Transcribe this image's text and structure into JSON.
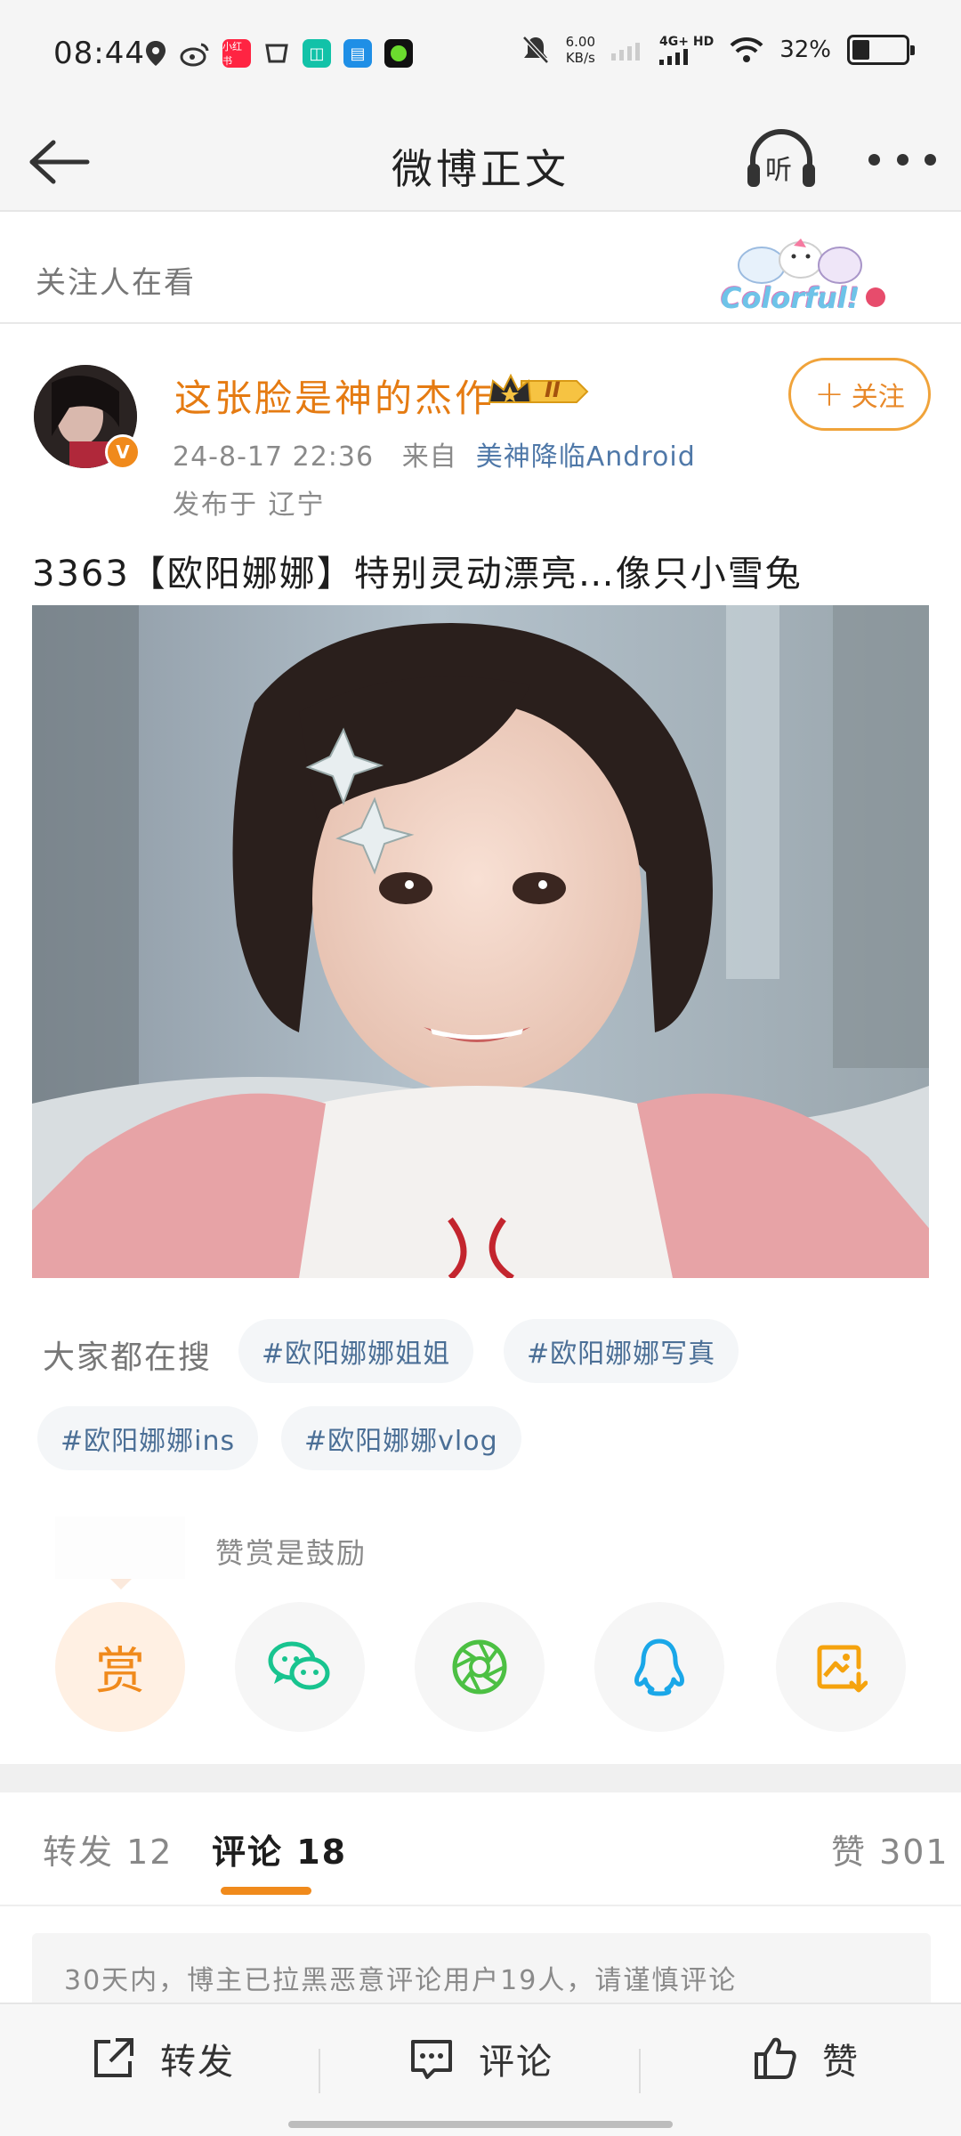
{
  "status_bar": {
    "time": "08:44",
    "net_speed_value": "6.00",
    "net_speed_unit": "KB/s",
    "network": "4G+ HD",
    "battery": "32%",
    "battery_level": 0.32,
    "app_icon_xhs_label": "小红书"
  },
  "header": {
    "title": "微博正文",
    "listen_label": "听"
  },
  "follow_strip": {
    "text": "关注人在看",
    "badge_text": "Colorful!"
  },
  "post": {
    "author": "这张脸是神的杰作",
    "level": "II",
    "verified_mark": "V",
    "time": "24-8-17 22:36",
    "from_label": "来自",
    "source": "美神降临Android",
    "location": "发布于 辽宁",
    "follow_label": "关注",
    "follow_plus": "+",
    "text": "3363【欧阳娜娜】特别灵动漂亮…像只小雪兔"
  },
  "hot_search": {
    "label": "大家都在搜",
    "tags": [
      "#欧阳娜娜姐姐",
      "#欧阳娜娜写真",
      "#欧阳娜娜ins",
      "#欧阳娜娜vlog"
    ]
  },
  "reward": {
    "hint": "赞赏是鼓励",
    "reward_char": "赏"
  },
  "tabs": {
    "repost": "转发 12",
    "comments": "评论 18",
    "likes": "赞 301"
  },
  "notice": "30天内，博主已拉黑恶意评论用户19人，请谨慎评论",
  "bottom_bar": {
    "repost": "转发",
    "comment": "评论",
    "like": "赞"
  },
  "colors": {
    "accent_orange": "#f08a1c",
    "author_orange": "#e57b12",
    "link_blue": "#4f78a8",
    "tag_blue": "#4b6f96"
  }
}
